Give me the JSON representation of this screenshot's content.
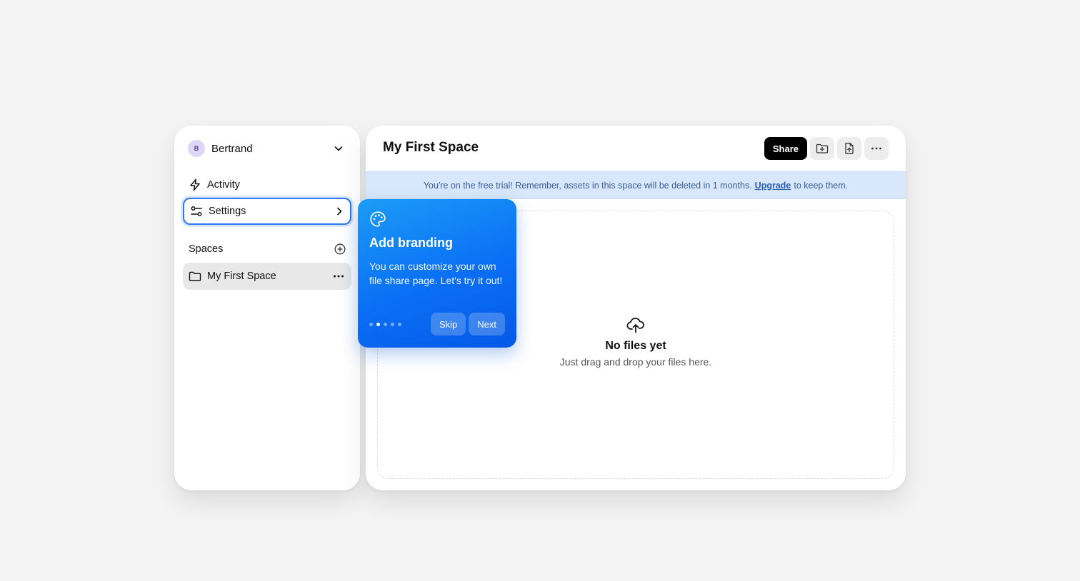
{
  "sidebar": {
    "user": {
      "initial": "B",
      "name": "Bertrand"
    },
    "nav": [
      {
        "label": "Activity",
        "icon": "lightning-icon"
      },
      {
        "label": "Settings",
        "icon": "sliders-icon"
      }
    ],
    "spaces": {
      "heading": "Spaces",
      "items": [
        {
          "label": "My First Space",
          "icon": "folder-icon"
        }
      ]
    }
  },
  "main": {
    "title": "My First Space",
    "toolbar": {
      "share_label": "Share"
    },
    "banner": {
      "text_before": "You're on the free trial! Remember, assets in this space will be deleted in 1 months.",
      "link": "Upgrade",
      "text_after": "to keep them."
    },
    "empty": {
      "title": "No files yet",
      "subtitle": "Just drag and drop your files here."
    }
  },
  "popover": {
    "title": "Add branding",
    "text": "You can customize your own file share page. Let's try it out!",
    "step": 2,
    "total_steps": 5,
    "skip_label": "Skip",
    "next_label": "Next"
  },
  "colors": {
    "accent": "#2b78f0",
    "banner_bg": "#d8e7fb",
    "popover_start": "#1c9cf7",
    "popover_end": "#0559e6"
  }
}
